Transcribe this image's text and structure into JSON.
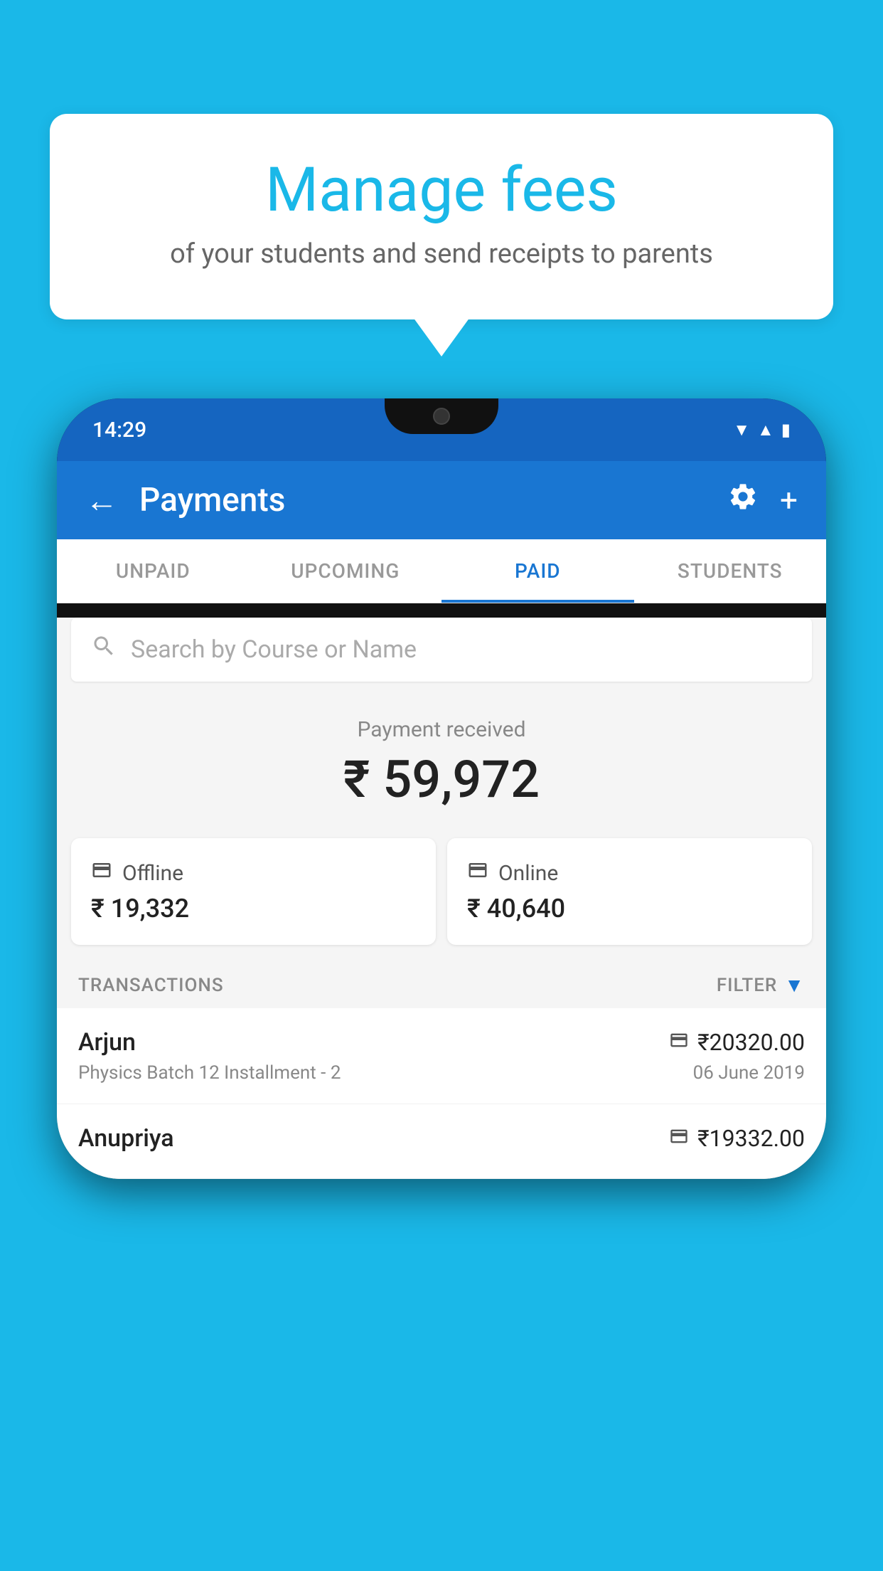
{
  "background_color": "#1ab8e8",
  "speech_bubble": {
    "title": "Manage fees",
    "subtitle": "of your students and send receipts to parents"
  },
  "status_bar": {
    "time": "14:29",
    "icons": [
      "wifi",
      "signal",
      "battery"
    ]
  },
  "header": {
    "title": "Payments",
    "back_label": "←",
    "settings_label": "⚙",
    "add_label": "+"
  },
  "tabs": [
    {
      "label": "UNPAID",
      "active": false
    },
    {
      "label": "UPCOMING",
      "active": false
    },
    {
      "label": "PAID",
      "active": true
    },
    {
      "label": "STUDENTS",
      "active": false
    }
  ],
  "search": {
    "placeholder": "Search by Course or Name"
  },
  "payment_summary": {
    "label": "Payment received",
    "amount": "₹ 59,972",
    "offline": {
      "type": "Offline",
      "amount": "₹ 19,332"
    },
    "online": {
      "type": "Online",
      "amount": "₹ 40,640"
    }
  },
  "transactions": {
    "label": "TRANSACTIONS",
    "filter_label": "FILTER",
    "rows": [
      {
        "name": "Arjun",
        "course": "Physics Batch 12 Installment - 2",
        "amount": "₹20320.00",
        "date": "06 June 2019",
        "payment_type": "online"
      },
      {
        "name": "Anupriya",
        "course": "",
        "amount": "₹19332.00",
        "date": "",
        "payment_type": "offline"
      }
    ]
  }
}
